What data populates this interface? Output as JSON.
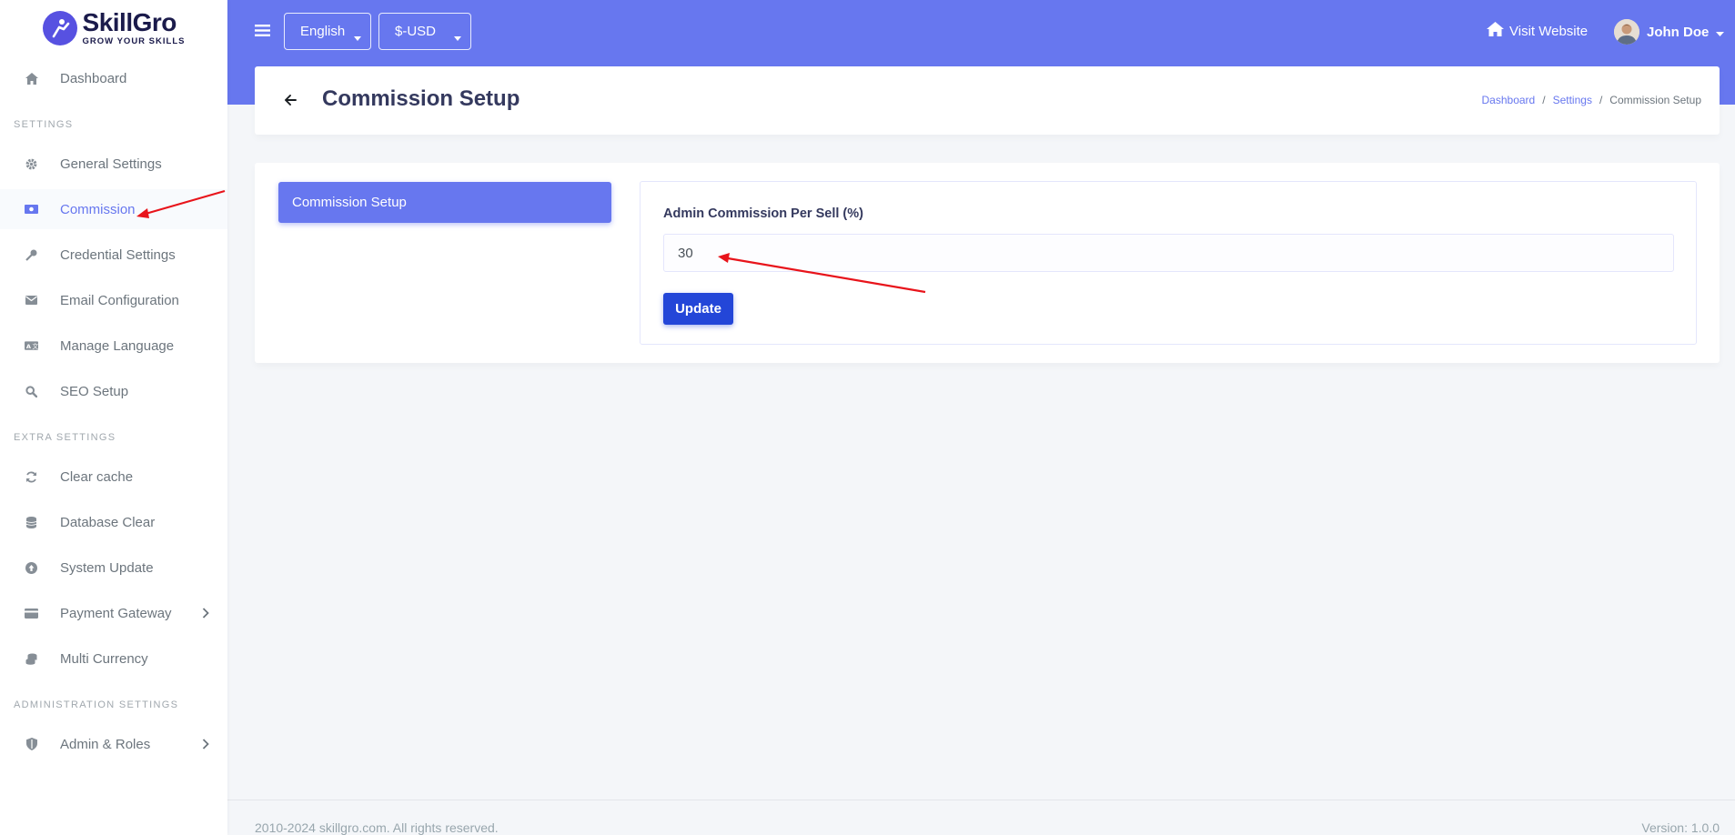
{
  "brand": {
    "name": "SkillGro",
    "tagline": "GROW YOUR SKILLS"
  },
  "sidebar": {
    "dashboard": {
      "label": "Dashboard",
      "icon": "home-icon"
    },
    "sections": [
      {
        "header": "SETTINGS"
      },
      {
        "header": "EXTRA SETTINGS"
      },
      {
        "header": "ADMINISTRATION SETTINGS"
      }
    ],
    "items": [
      {
        "label": "General Settings",
        "icon": "gear-icon"
      },
      {
        "label": "Commission",
        "icon": "money-icon",
        "active": true
      },
      {
        "label": "Credential Settings",
        "icon": "key-icon"
      },
      {
        "label": "Email Configuration",
        "icon": "envelope-icon"
      },
      {
        "label": "Manage Language",
        "icon": "language-icon"
      },
      {
        "label": "SEO Setup",
        "icon": "search-icon"
      },
      {
        "label": "Clear cache",
        "icon": "sync-icon"
      },
      {
        "label": "Database Clear",
        "icon": "database-icon"
      },
      {
        "label": "System Update",
        "icon": "upload-icon"
      },
      {
        "label": "Payment Gateway",
        "icon": "credit-card-icon"
      },
      {
        "label": "Multi Currency",
        "icon": "coins-icon"
      },
      {
        "label": "Admin & Roles",
        "icon": "shield-icon"
      }
    ]
  },
  "topbar": {
    "language": "English",
    "currency": "$-USD",
    "visit_website": "Visit Website",
    "user_name": "John Doe"
  },
  "header": {
    "title": "Commission Setup",
    "breadcrumb": [
      "Dashboard",
      "Settings",
      "Commission Setup"
    ]
  },
  "main": {
    "tab_label": "Commission Setup",
    "field_label": "Admin Commission Per Sell (%)",
    "field_value": "30",
    "update_label": "Update"
  },
  "footer": {
    "copyright": "2010-2024 skillgro.com. All rights reserved.",
    "version": "Version: 1.0.0"
  },
  "colors": {
    "primary": "#6777ef",
    "button": "#2346d8",
    "annotation": "#e8141b"
  }
}
